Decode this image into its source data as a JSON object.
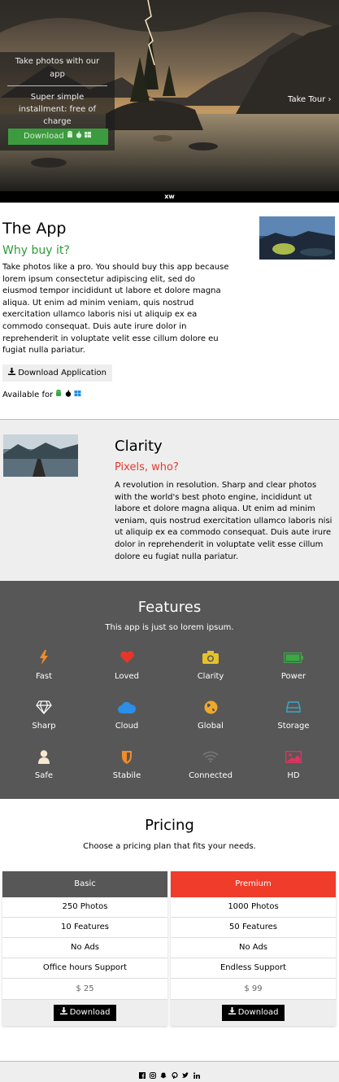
{
  "hero": {
    "card_line1": "Take photos with our app",
    "card_line2": "Super simple installment: free of charge",
    "download_label": "Download",
    "platform_icons": [
      "android-icon",
      "apple-icon",
      "windows-icon"
    ],
    "take_tour_label": "Take Tour ›",
    "brand_bar_text": "xw"
  },
  "app": {
    "title": "The App",
    "subtitle": "Why buy it?",
    "body": "Take photos like a pro. You should buy this app because lorem ipsum consectetur adipiscing elit, sed do eiusmod tempor incididunt ut labore et dolore magna aliqua. Ut enim ad minim veniam, quis nostrud exercitation ullamco laboris nisi ut aliquip ex ea commodo consequat. Duis aute irure dolor in reprehenderit in voluptate velit esse cillum dolore eu fugiat nulla pariatur.",
    "download_label": "Download Application",
    "available_label": "Available for"
  },
  "clarity": {
    "title": "Clarity",
    "subtitle": "Pixels, who?",
    "body": "A revolution in resolution. Sharp and clear photos with the world's best photo engine, incididunt ut labore et dolore magna aliqua. Ut enim ad minim veniam, quis nostrud exercitation ullamco laboris nisi ut aliquip ex ea commodo consequat. Duis aute irure dolor in reprehenderit in voluptate velit esse cillum dolore eu fugiat nulla pariatur."
  },
  "features": {
    "title": "Features",
    "subtitle": "This app is just so lorem ipsum.",
    "items": [
      {
        "label": "Fast",
        "icon": "bolt-icon",
        "color": "#f08c2a"
      },
      {
        "label": "Loved",
        "icon": "heart-icon",
        "color": "#e8352b"
      },
      {
        "label": "Clarity",
        "icon": "camera-icon",
        "color": "#e6c12a"
      },
      {
        "label": "Power",
        "icon": "battery-icon",
        "color": "#3aa845"
      },
      {
        "label": "Sharp",
        "icon": "diamond-icon",
        "color": "#ffffff"
      },
      {
        "label": "Cloud",
        "icon": "cloud-icon",
        "color": "#2c8ee6"
      },
      {
        "label": "Global",
        "icon": "globe-icon",
        "color": "#f0a82a"
      },
      {
        "label": "Storage",
        "icon": "hdd-icon",
        "color": "#36a9c9"
      },
      {
        "label": "Safe",
        "icon": "user-icon",
        "color": "#f6e8cf"
      },
      {
        "label": "Stabile",
        "icon": "shield-icon",
        "color": "#f08c2a"
      },
      {
        "label": "Connected",
        "icon": "wifi-icon",
        "color": "#777777"
      },
      {
        "label": "HD",
        "icon": "image-icon",
        "color": "#e0345f"
      }
    ]
  },
  "pricing": {
    "title": "Pricing",
    "subtitle": "Choose a pricing plan that fits your needs.",
    "plans": [
      {
        "name": "Basic",
        "color": "#575757",
        "rows": [
          "250 Photos",
          "10 Features",
          "No Ads",
          "Office hours Support"
        ],
        "price": "$ 25",
        "button": "Download"
      },
      {
        "name": "Premium",
        "color": "#f03c2a",
        "rows": [
          "1000 Photos",
          "50 Features",
          "No Ads",
          "Endless Support"
        ],
        "price": "$ 99",
        "button": "Download"
      }
    ]
  },
  "footer": {
    "social_icons": [
      "facebook-icon",
      "instagram-icon",
      "snapchat-icon",
      "pinterest-icon",
      "twitter-icon",
      "linkedin-icon"
    ]
  }
}
